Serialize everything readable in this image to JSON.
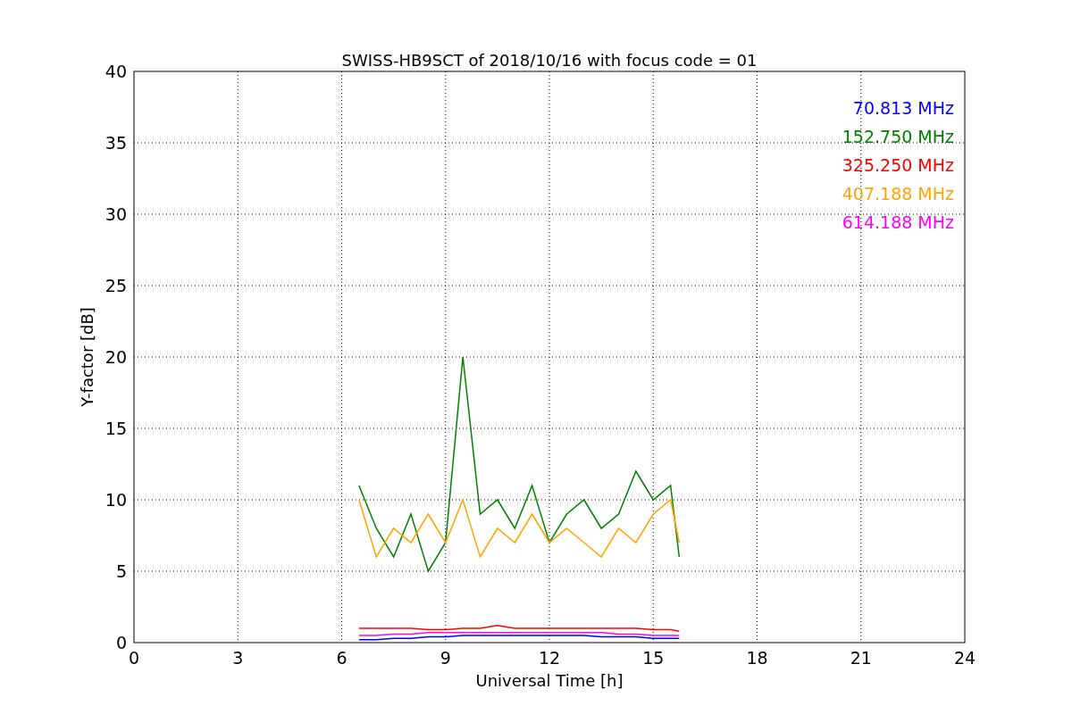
{
  "chart_data": {
    "type": "line",
    "title": "SWISS-HB9SCT of 2018/10/16 with focus code = 01",
    "xlabel": "Universal Time [h]",
    "ylabel": "Y-factor [dB]",
    "x": [
      6.5,
      7,
      7.5,
      8,
      8.5,
      9,
      9.5,
      10,
      10.5,
      11,
      11.5,
      12,
      12.5,
      13,
      13.5,
      14,
      14.5,
      15,
      15.5,
      15.75
    ],
    "series": [
      {
        "name": "70.813 MHz",
        "color": "#0000ff",
        "values": [
          0.2,
          0.2,
          0.3,
          0.3,
          0.4,
          0.4,
          0.5,
          0.5,
          0.5,
          0.5,
          0.5,
          0.5,
          0.5,
          0.5,
          0.4,
          0.4,
          0.4,
          0.3,
          0.3,
          0.3
        ]
      },
      {
        "name": "152.750 MHz",
        "color": "#008000",
        "values": [
          11,
          8,
          6,
          9,
          5,
          7,
          20,
          9,
          10,
          8,
          11,
          7,
          9,
          10,
          8,
          9,
          12,
          10,
          11,
          6
        ]
      },
      {
        "name": "325.250 MHz",
        "color": "#ff0000",
        "values": [
          1,
          1,
          1,
          1,
          0.9,
          0.9,
          1,
          1,
          1.2,
          1,
          1,
          1,
          1,
          1,
          1,
          1,
          1,
          0.9,
          0.9,
          0.8
        ]
      },
      {
        "name": "407.188 MHz",
        "color": "#ffa500",
        "values": [
          10,
          6,
          8,
          7,
          9,
          7,
          10,
          6,
          8,
          7,
          9,
          7,
          8,
          7,
          6,
          8,
          7,
          9,
          10,
          7
        ]
      },
      {
        "name": "614.188 MHz",
        "color": "#ff00ff",
        "values": [
          0.5,
          0.5,
          0.6,
          0.6,
          0.7,
          0.7,
          0.7,
          0.7,
          0.7,
          0.7,
          0.7,
          0.7,
          0.7,
          0.7,
          0.7,
          0.6,
          0.6,
          0.5,
          0.5,
          0.5
        ]
      }
    ],
    "xlim": [
      0,
      24
    ],
    "ylim": [
      0,
      40
    ],
    "xticks": [
      0,
      3,
      6,
      9,
      12,
      15,
      18,
      21,
      24
    ],
    "yticks": [
      0,
      5,
      10,
      15,
      20,
      25,
      30,
      35,
      40
    ],
    "grid": true
  }
}
